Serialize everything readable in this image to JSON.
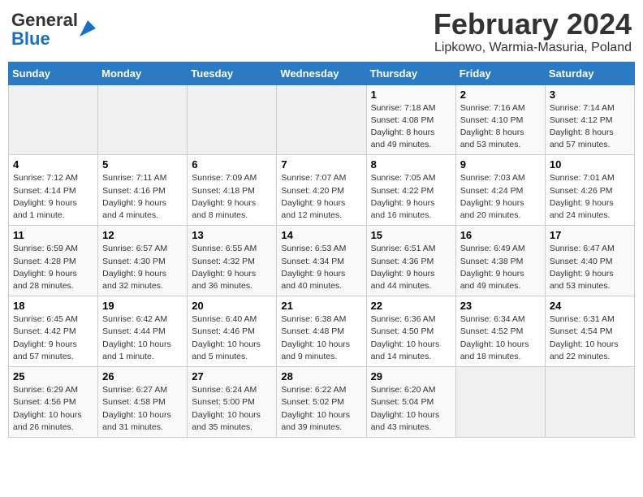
{
  "header": {
    "logo_general": "General",
    "logo_blue": "Blue",
    "month_title": "February 2024",
    "location": "Lipkowo, Warmia-Masuria, Poland"
  },
  "weekdays": [
    "Sunday",
    "Monday",
    "Tuesday",
    "Wednesday",
    "Thursday",
    "Friday",
    "Saturday"
  ],
  "weeks": [
    [
      {
        "day": "",
        "info": ""
      },
      {
        "day": "",
        "info": ""
      },
      {
        "day": "",
        "info": ""
      },
      {
        "day": "",
        "info": ""
      },
      {
        "day": "1",
        "info": "Sunrise: 7:18 AM\nSunset: 4:08 PM\nDaylight: 8 hours\nand 49 minutes."
      },
      {
        "day": "2",
        "info": "Sunrise: 7:16 AM\nSunset: 4:10 PM\nDaylight: 8 hours\nand 53 minutes."
      },
      {
        "day": "3",
        "info": "Sunrise: 7:14 AM\nSunset: 4:12 PM\nDaylight: 8 hours\nand 57 minutes."
      }
    ],
    [
      {
        "day": "4",
        "info": "Sunrise: 7:12 AM\nSunset: 4:14 PM\nDaylight: 9 hours\nand 1 minute."
      },
      {
        "day": "5",
        "info": "Sunrise: 7:11 AM\nSunset: 4:16 PM\nDaylight: 9 hours\nand 4 minutes."
      },
      {
        "day": "6",
        "info": "Sunrise: 7:09 AM\nSunset: 4:18 PM\nDaylight: 9 hours\nand 8 minutes."
      },
      {
        "day": "7",
        "info": "Sunrise: 7:07 AM\nSunset: 4:20 PM\nDaylight: 9 hours\nand 12 minutes."
      },
      {
        "day": "8",
        "info": "Sunrise: 7:05 AM\nSunset: 4:22 PM\nDaylight: 9 hours\nand 16 minutes."
      },
      {
        "day": "9",
        "info": "Sunrise: 7:03 AM\nSunset: 4:24 PM\nDaylight: 9 hours\nand 20 minutes."
      },
      {
        "day": "10",
        "info": "Sunrise: 7:01 AM\nSunset: 4:26 PM\nDaylight: 9 hours\nand 24 minutes."
      }
    ],
    [
      {
        "day": "11",
        "info": "Sunrise: 6:59 AM\nSunset: 4:28 PM\nDaylight: 9 hours\nand 28 minutes."
      },
      {
        "day": "12",
        "info": "Sunrise: 6:57 AM\nSunset: 4:30 PM\nDaylight: 9 hours\nand 32 minutes."
      },
      {
        "day": "13",
        "info": "Sunrise: 6:55 AM\nSunset: 4:32 PM\nDaylight: 9 hours\nand 36 minutes."
      },
      {
        "day": "14",
        "info": "Sunrise: 6:53 AM\nSunset: 4:34 PM\nDaylight: 9 hours\nand 40 minutes."
      },
      {
        "day": "15",
        "info": "Sunrise: 6:51 AM\nSunset: 4:36 PM\nDaylight: 9 hours\nand 44 minutes."
      },
      {
        "day": "16",
        "info": "Sunrise: 6:49 AM\nSunset: 4:38 PM\nDaylight: 9 hours\nand 49 minutes."
      },
      {
        "day": "17",
        "info": "Sunrise: 6:47 AM\nSunset: 4:40 PM\nDaylight: 9 hours\nand 53 minutes."
      }
    ],
    [
      {
        "day": "18",
        "info": "Sunrise: 6:45 AM\nSunset: 4:42 PM\nDaylight: 9 hours\nand 57 minutes."
      },
      {
        "day": "19",
        "info": "Sunrise: 6:42 AM\nSunset: 4:44 PM\nDaylight: 10 hours\nand 1 minute."
      },
      {
        "day": "20",
        "info": "Sunrise: 6:40 AM\nSunset: 4:46 PM\nDaylight: 10 hours\nand 5 minutes."
      },
      {
        "day": "21",
        "info": "Sunrise: 6:38 AM\nSunset: 4:48 PM\nDaylight: 10 hours\nand 9 minutes."
      },
      {
        "day": "22",
        "info": "Sunrise: 6:36 AM\nSunset: 4:50 PM\nDaylight: 10 hours\nand 14 minutes."
      },
      {
        "day": "23",
        "info": "Sunrise: 6:34 AM\nSunset: 4:52 PM\nDaylight: 10 hours\nand 18 minutes."
      },
      {
        "day": "24",
        "info": "Sunrise: 6:31 AM\nSunset: 4:54 PM\nDaylight: 10 hours\nand 22 minutes."
      }
    ],
    [
      {
        "day": "25",
        "info": "Sunrise: 6:29 AM\nSunset: 4:56 PM\nDaylight: 10 hours\nand 26 minutes."
      },
      {
        "day": "26",
        "info": "Sunrise: 6:27 AM\nSunset: 4:58 PM\nDaylight: 10 hours\nand 31 minutes."
      },
      {
        "day": "27",
        "info": "Sunrise: 6:24 AM\nSunset: 5:00 PM\nDaylight: 10 hours\nand 35 minutes."
      },
      {
        "day": "28",
        "info": "Sunrise: 6:22 AM\nSunset: 5:02 PM\nDaylight: 10 hours\nand 39 minutes."
      },
      {
        "day": "29",
        "info": "Sunrise: 6:20 AM\nSunset: 5:04 PM\nDaylight: 10 hours\nand 43 minutes."
      },
      {
        "day": "",
        "info": ""
      },
      {
        "day": "",
        "info": ""
      }
    ]
  ]
}
